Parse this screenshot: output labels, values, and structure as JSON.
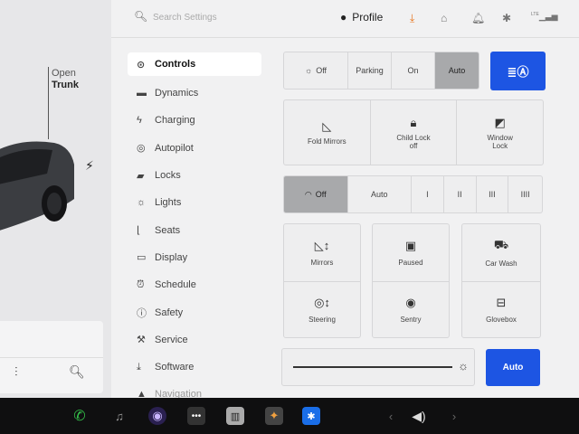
{
  "car": {
    "trunk_line1": "Open",
    "trunk_line2": "Trunk"
  },
  "topbar": {
    "search_placeholder": "Search Settings",
    "profile_label": "Profile",
    "lte_label": "LTE"
  },
  "nav": {
    "items": [
      {
        "label": "Controls",
        "icon": "toggle-icon"
      },
      {
        "label": "Dynamics",
        "icon": "car-icon"
      },
      {
        "label": "Charging",
        "icon": "bolt-icon"
      },
      {
        "label": "Autopilot",
        "icon": "steering-wheel-icon"
      },
      {
        "label": "Locks",
        "icon": "lock-icon"
      },
      {
        "label": "Lights",
        "icon": "sun-icon"
      },
      {
        "label": "Seats",
        "icon": "seat-icon"
      },
      {
        "label": "Display",
        "icon": "display-icon"
      },
      {
        "label": "Schedule",
        "icon": "alarm-icon"
      },
      {
        "label": "Safety",
        "icon": "info-icon"
      },
      {
        "label": "Service",
        "icon": "wrench-icon"
      },
      {
        "label": "Software",
        "icon": "download-icon"
      },
      {
        "label": "Navigation",
        "icon": "navigation-icon"
      }
    ]
  },
  "lights": {
    "options": [
      "Off",
      "Parking",
      "On",
      "Auto"
    ],
    "selected": "Auto",
    "headlight_button_color": "#1d55e3"
  },
  "tiles": {
    "fold_mirrors": "Fold Mirrors",
    "child_lock": "Child Lock",
    "child_lock_state": "off",
    "window_lock_line1": "Window",
    "window_lock_line2": "Lock"
  },
  "wipers": {
    "options": [
      "Off",
      "Auto",
      "I",
      "II",
      "III",
      "IIII"
    ],
    "selected": "Off"
  },
  "grid": {
    "mirrors": "Mirrors",
    "steering": "Steering",
    "paused": "Paused",
    "sentry": "Sentry",
    "car_wash": "Car Wash",
    "glovebox": "Glovebox"
  },
  "brightness": {
    "auto_label": "Auto",
    "level": 1.0
  },
  "colors": {
    "accent": "#1d55e3",
    "selected_segment": "#a8a9ab",
    "download_icon": "#e8741c"
  }
}
